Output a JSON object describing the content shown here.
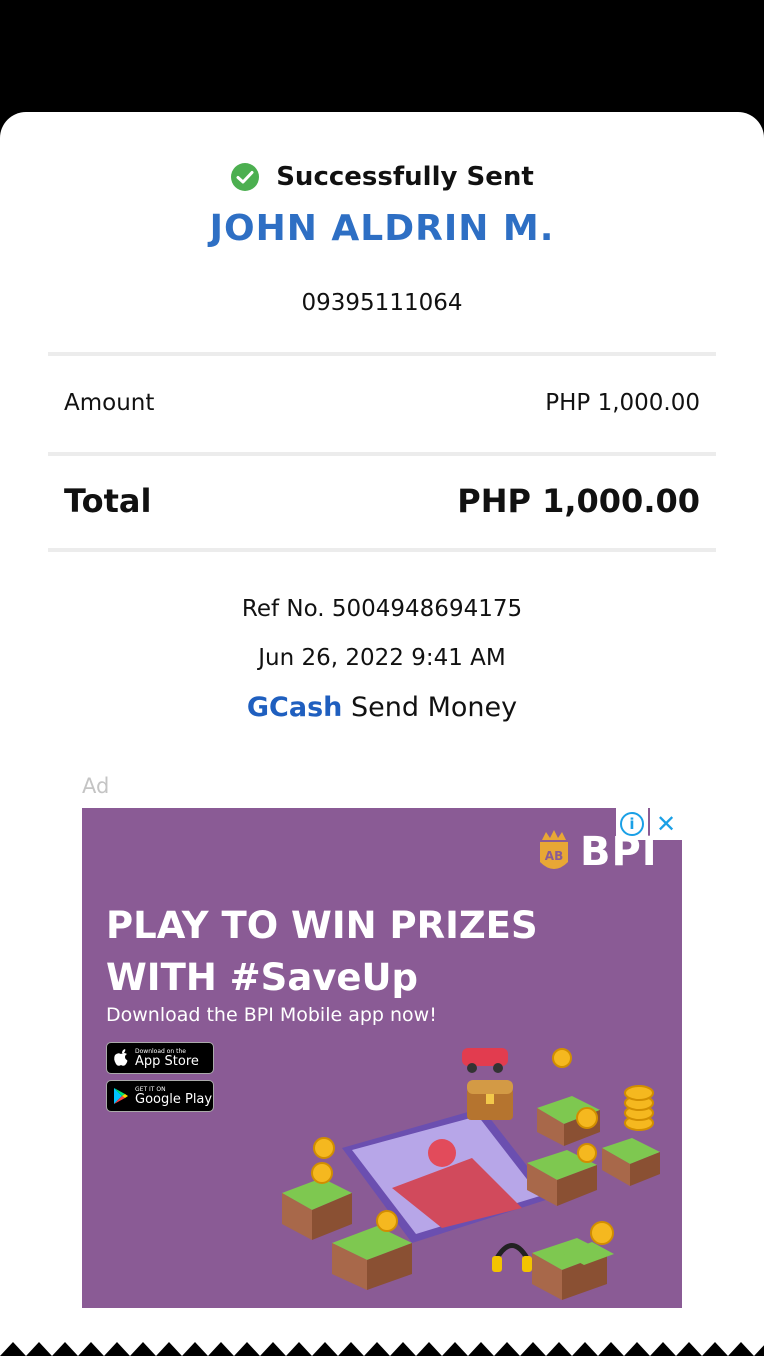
{
  "status": {
    "label": "Successfully Sent",
    "color": "#4caf50"
  },
  "recipient": {
    "name": "JOHN ALDRIN M.",
    "number": "09395111064"
  },
  "amount": {
    "label": "Amount",
    "value": "PHP 1,000.00"
  },
  "total": {
    "label": "Total",
    "value": "PHP 1,000.00"
  },
  "transaction": {
    "ref": "Ref No. 5004948694175",
    "datetime": "Jun 26, 2022 9:41 AM",
    "brand": "GCash",
    "service": "Send Money"
  },
  "ad": {
    "label": "Ad",
    "advertiser": "BPI",
    "headline_1": "PLAY TO WIN PRIZES",
    "headline_2": "WITH #SaveUp",
    "subline": "Download the BPI Mobile app now!",
    "app_store_small": "Download on the",
    "app_store": "App Store",
    "google_play_small": "GET IT ON",
    "google_play": "Google Play",
    "info_icon": "i",
    "close_icon": "✕"
  }
}
